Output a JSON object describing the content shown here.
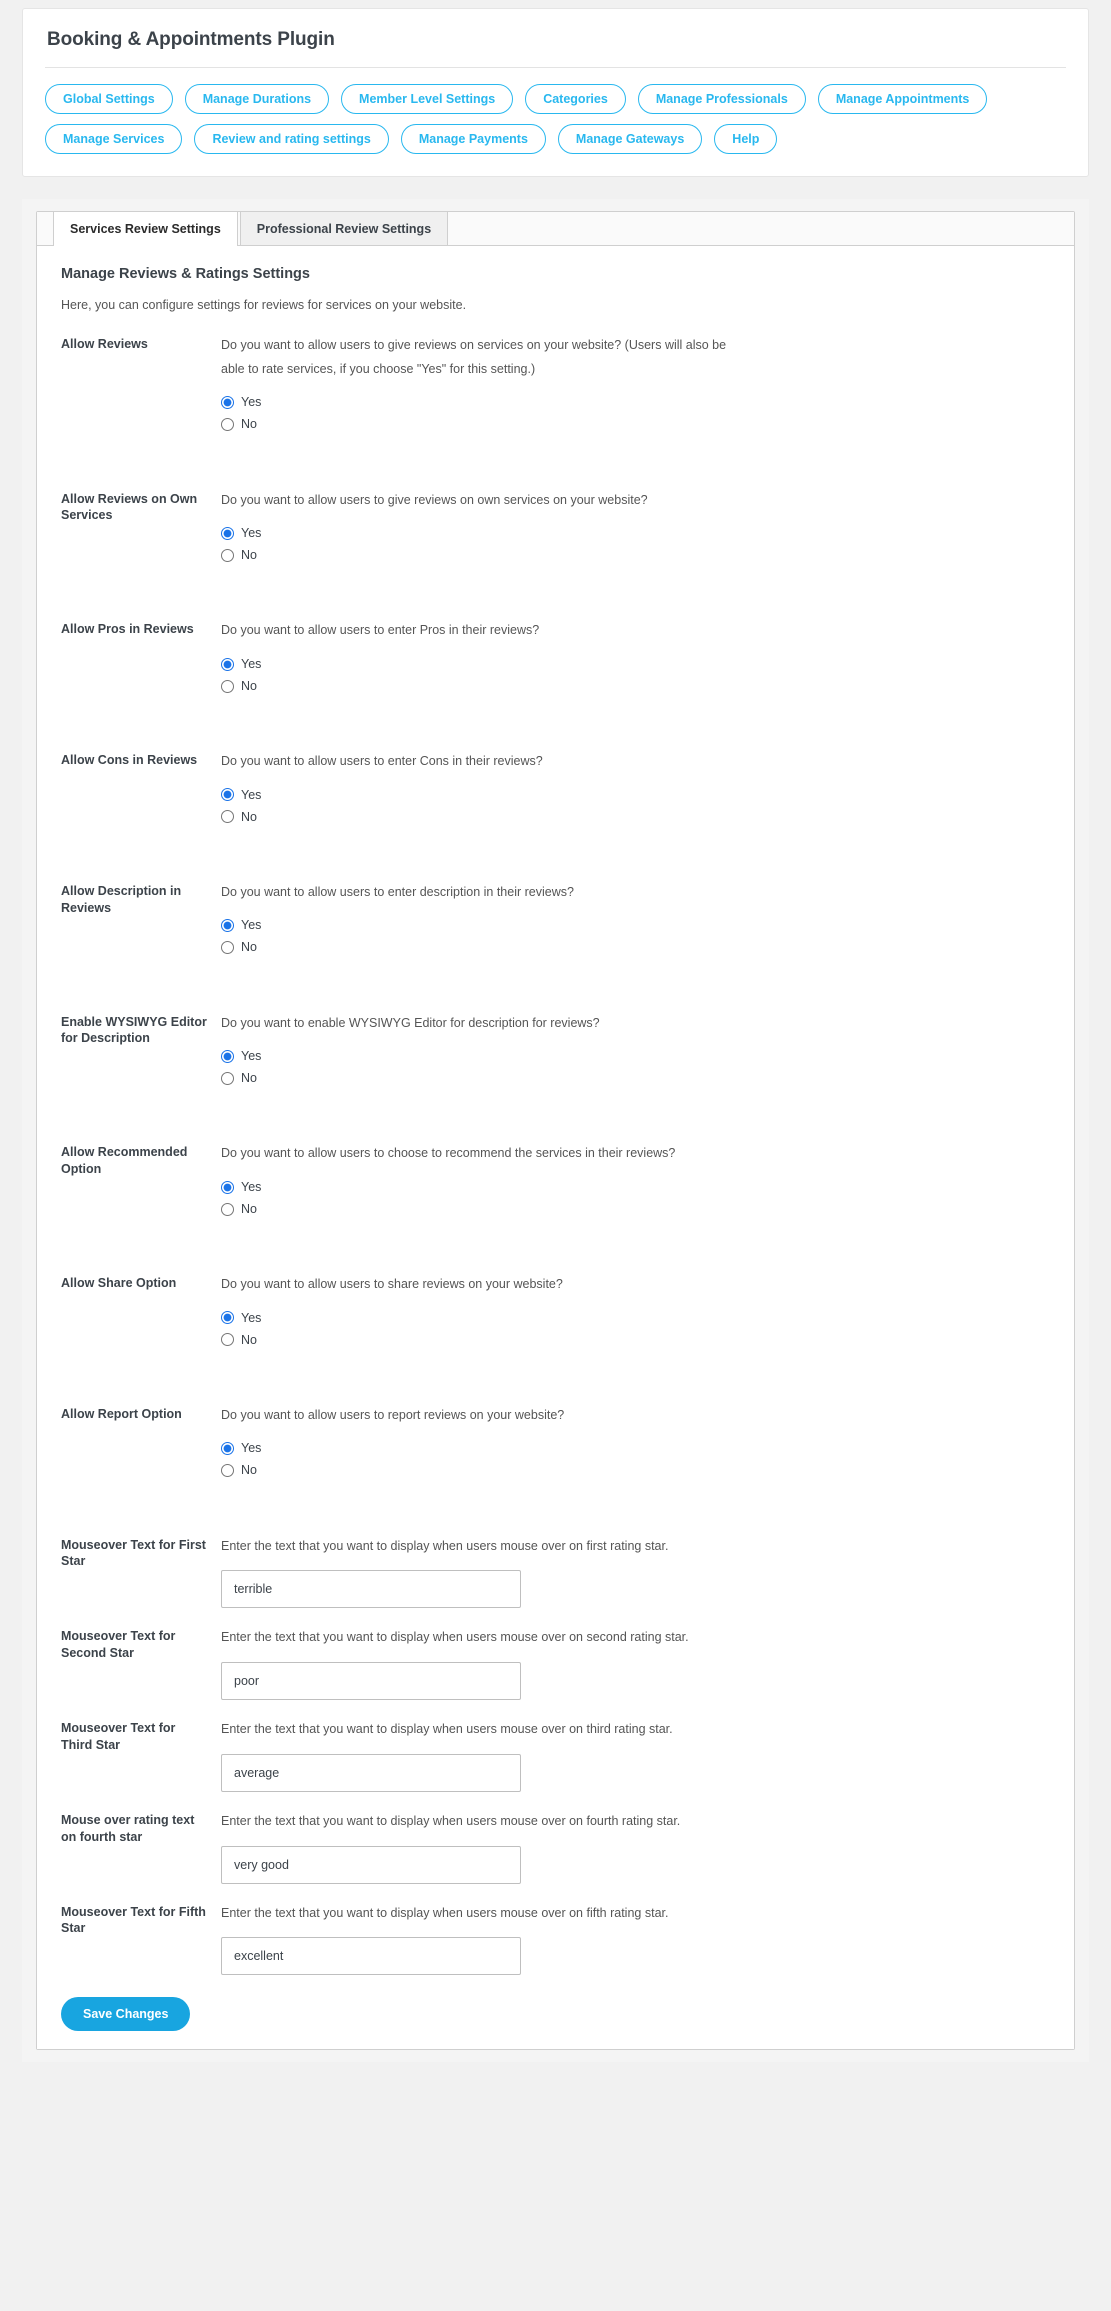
{
  "header": {
    "title": "Booking & Appointments Plugin",
    "nav_buttons": [
      "Global Settings",
      "Manage Durations",
      "Member Level Settings",
      "Categories",
      "Manage Professionals",
      "Manage Appointments",
      "Manage Services",
      "Review and rating settings",
      "Manage Payments",
      "Manage Gateways",
      "Help"
    ]
  },
  "tabs": [
    {
      "label": "Services Review Settings",
      "active": true
    },
    {
      "label": "Professional Review Settings",
      "active": false
    }
  ],
  "panel": {
    "heading": "Manage Reviews & Ratings Settings",
    "subheading": "Here, you can configure settings for reviews for services on your website.",
    "radio_yes": "Yes",
    "radio_no": "No",
    "save_label": "Save Changes"
  },
  "settings": [
    {
      "label": "Allow Reviews",
      "description": "Do you want to allow users to give reviews on services on your website? (Users will also be able to rate services, if you choose \"Yes\" for this setting.)",
      "type": "radio",
      "value": "Yes"
    },
    {
      "label": "Allow Reviews on Own Services",
      "description": "Do you want to allow users to give reviews on own services on your website?",
      "type": "radio",
      "value": "Yes"
    },
    {
      "label": "Allow Pros in Reviews",
      "description": "Do you want to allow users to enter Pros in their reviews?",
      "type": "radio",
      "value": "Yes"
    },
    {
      "label": "Allow Cons in Reviews",
      "description": "Do you want to allow users to enter Cons in their reviews?",
      "type": "radio",
      "value": "Yes"
    },
    {
      "label": "Allow Description in Reviews",
      "description": "Do you want to allow users to enter description in their reviews?",
      "type": "radio",
      "value": "Yes"
    },
    {
      "label": "Enable WYSIWYG Editor for Description",
      "description": "Do you want to enable WYSIWYG Editor for description for reviews?",
      "type": "radio",
      "value": "Yes"
    },
    {
      "label": "Allow Recommended Option",
      "description": "Do you want to allow users to choose to recommend the services in their reviews?",
      "type": "radio",
      "value": "Yes"
    },
    {
      "label": "Allow Share Option",
      "description": "Do you want to allow users to share reviews on your website?",
      "type": "radio",
      "value": "Yes"
    },
    {
      "label": "Allow Report Option",
      "description": "Do you want to allow users to report reviews on your website?",
      "type": "radio",
      "value": "Yes"
    },
    {
      "label": "Mouseover Text for First Star",
      "description": "Enter the text that you want to display when users mouse over on first rating star.",
      "type": "text",
      "value": "terrible"
    },
    {
      "label": "Mouseover Text for Second Star",
      "description": "Enter the text that you want to display when users mouse over on second rating star.",
      "type": "text",
      "value": "poor"
    },
    {
      "label": "Mouseover Text for Third Star",
      "description": "Enter the text that you want to display when users mouse over on third rating star.",
      "type": "text",
      "value": "average"
    },
    {
      "label": "Mouse over rating text on fourth star",
      "description": "Enter the text that you want to display when users mouse over on fourth rating star.",
      "type": "text",
      "value": "very good"
    },
    {
      "label": "Mouseover Text for Fifth Star",
      "description": "Enter the text that you want to display when users mouse over on fifth rating star.",
      "type": "text",
      "value": "excellent"
    }
  ],
  "colors": {
    "accent": "#29b8ef",
    "save_button": "#18a5e0",
    "text": "#3c434a",
    "radio_selected": "#1a73e8"
  }
}
